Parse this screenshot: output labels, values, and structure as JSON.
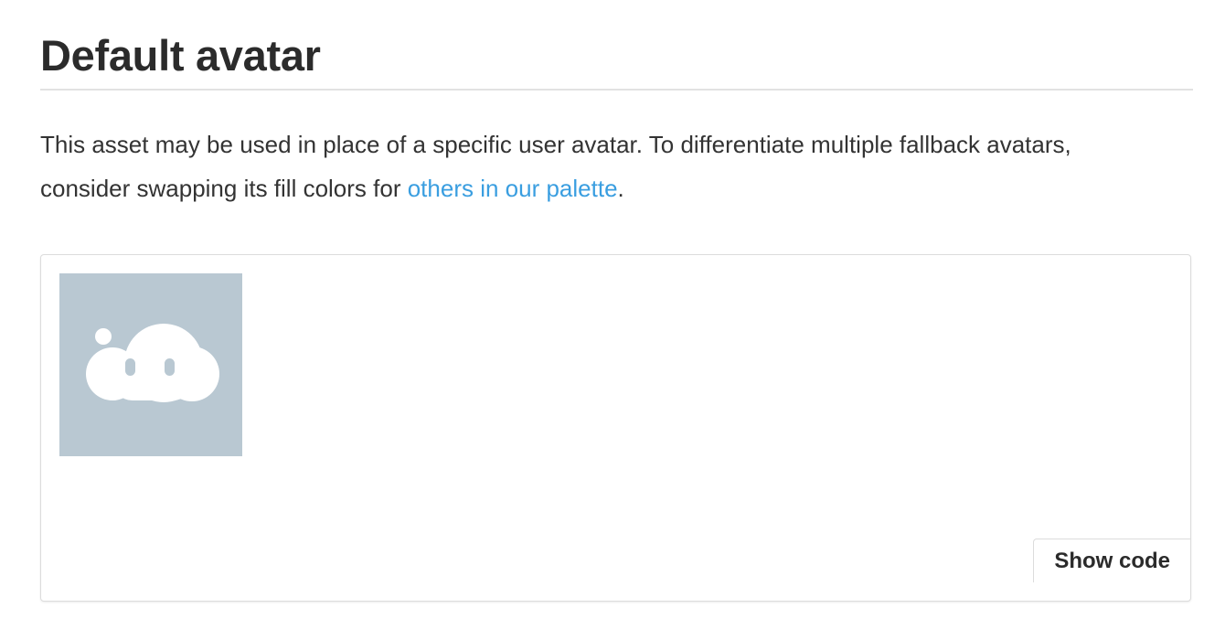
{
  "page": {
    "title": "Default avatar",
    "description_before_link": "This asset may be used in place of a specific user avatar. To differentiate multiple fallback avatars, consider swapping its fill colors for ",
    "link_text": "others in our palette",
    "description_after_link": "."
  },
  "preview": {
    "avatar_icon": "cloud-face-icon",
    "avatar_background_color": "#b9c8d2",
    "avatar_foreground_color": "#ffffff",
    "show_code_label": "Show code"
  },
  "colors": {
    "link": "#3a9ee0",
    "text": "#333333",
    "heading": "#2b2b2b"
  }
}
